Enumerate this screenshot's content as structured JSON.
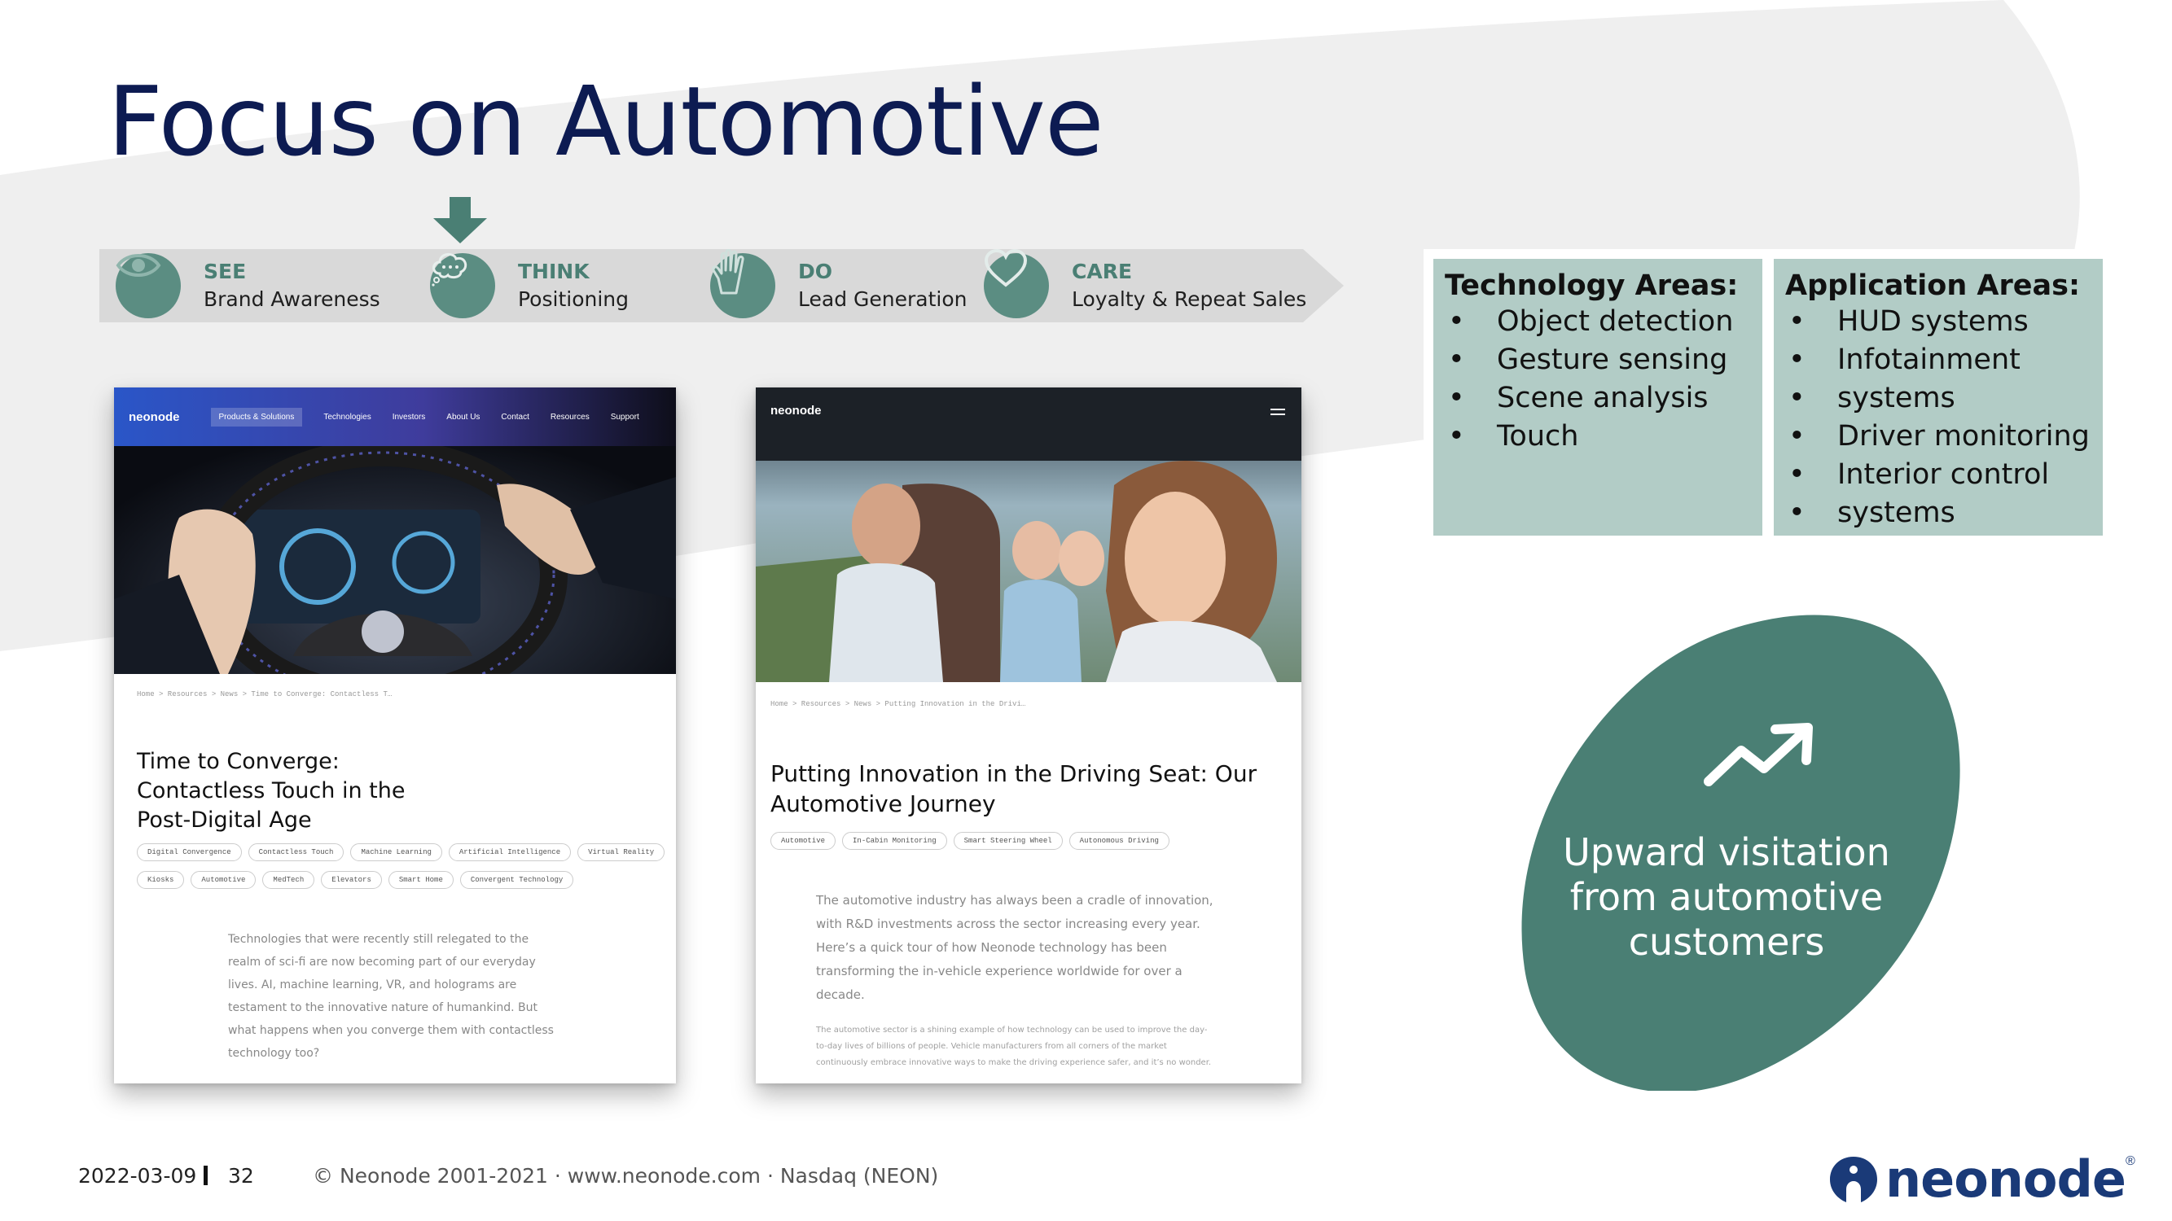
{
  "slide": {
    "title": "Focus on Automotive"
  },
  "funnel": {
    "stages": [
      {
        "name": "SEE",
        "desc": "Brand Awareness",
        "icon": "eye-icon"
      },
      {
        "name": "THINK",
        "desc": "Positioning",
        "icon": "thought-bubble-icon"
      },
      {
        "name": "DO",
        "desc": "Lead Generation",
        "icon": "hand-icon"
      },
      {
        "name": "CARE",
        "desc": "Loyalty & Repeat Sales",
        "icon": "heart-icon"
      }
    ],
    "highlighted_stage": "THINK"
  },
  "technology_areas": {
    "heading": "Technology Areas:",
    "items": [
      "Object detection",
      "Gesture sensing",
      "Scene analysis",
      "Touch"
    ]
  },
  "application_areas": {
    "heading": "Application Areas:",
    "items": [
      "HUD systems",
      "Infotainment",
      "systems",
      "Driver monitoring",
      "Interior control",
      "systems"
    ]
  },
  "callout": {
    "text_line1": "Upward visitation",
    "text_line2": "from automotive",
    "text_line3": "customers",
    "icon": "trend-up-icon"
  },
  "article1": {
    "brand": "neonode",
    "nav": [
      "Products & Solutions",
      "Technologies",
      "Investors",
      "About Us",
      "Contact",
      "Resources",
      "Support"
    ],
    "breadcrumb": "Home  >  Resources  >  News  >  Time to Converge: Contactless T…",
    "title_line1": "Time to Converge:",
    "title_line2": "Contactless Touch in the",
    "title_line3": "Post-Digital Age",
    "tags": [
      "Digital Convergence",
      "Contactless Touch",
      "Machine Learning",
      "Artificial Intelligence",
      "Virtual Reality",
      "Kiosks",
      "Automotive",
      "MedTech",
      "Elevators",
      "Smart Home",
      "Convergent Technology"
    ],
    "body": [
      "Technologies that were recently still relegated to the",
      "realm of sci-fi are now becoming part of our everyday",
      "lives. AI, machine learning, VR, and holograms are",
      "testament to the innovative nature of humankind. But",
      "what happens when you converge them with contactless",
      "technology too?"
    ]
  },
  "article2": {
    "brand": "neonode",
    "breadcrumb": "Home  >  Resources  >  News  >  Putting Innovation in the Drivi…",
    "title_line1": "Putting Innovation in the Driving Seat: Our",
    "title_line2": "Automotive Journey",
    "tags": [
      "Automotive",
      "In-Cabin Monitoring",
      "Smart Steering Wheel",
      "Autonomous Driving"
    ],
    "body": [
      "The automotive industry has always been a cradle of innovation,",
      "with R&D investments across the sector increasing every year.",
      "Here’s a quick tour of how Neonode technology has been",
      "transforming the in-vehicle experience worldwide for over a",
      "decade."
    ],
    "body_small": [
      "The automotive sector is a shining example of how technology can be used to improve the day-",
      "to-day lives of billions of people. Vehicle manufacturers from all corners of the market",
      "continuously embrace innovative ways to make the driving experience safer, and it’s no wonder."
    ]
  },
  "footer": {
    "date": "2022-03-09",
    "page": "32",
    "copyright": "© Neonode 2001-2021  ·  www.neonode.com  ·  Nasdaq (NEON)"
  },
  "logo": {
    "text": "neonode",
    "reg": "®"
  },
  "colors": {
    "title": "#0d1b52",
    "teal": "#4a7f74",
    "teal_light": "#b2ccc6",
    "band": "#d9d9d9",
    "logo": "#1a3a78"
  }
}
